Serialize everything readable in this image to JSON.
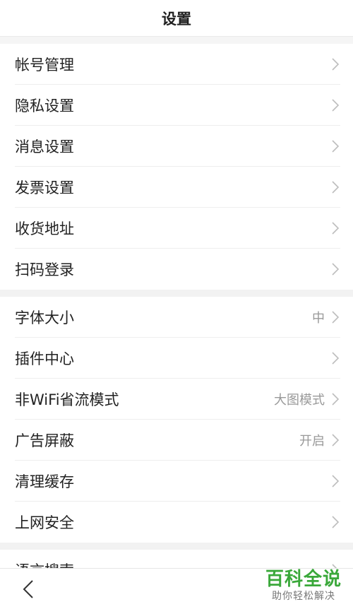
{
  "header": {
    "title": "设置"
  },
  "groups": [
    {
      "items": [
        {
          "label": "帐号管理",
          "value": ""
        },
        {
          "label": "隐私设置",
          "value": ""
        },
        {
          "label": "消息设置",
          "value": ""
        },
        {
          "label": "发票设置",
          "value": ""
        },
        {
          "label": "收货地址",
          "value": ""
        },
        {
          "label": "扫码登录",
          "value": ""
        }
      ]
    },
    {
      "items": [
        {
          "label": "字体大小",
          "value": "中"
        },
        {
          "label": "插件中心",
          "value": ""
        },
        {
          "label": "非WiFi省流模式",
          "value": "大图模式"
        },
        {
          "label": "广告屏蔽",
          "value": "开启"
        },
        {
          "label": "清理缓存",
          "value": ""
        },
        {
          "label": "上网安全",
          "value": ""
        }
      ]
    },
    {
      "items": [
        {
          "label": "语言搜索",
          "value": ""
        }
      ]
    }
  ],
  "watermark": {
    "title": "百科全说",
    "subtitle": "助你轻松解决"
  },
  "colors": {
    "accent": "#3aa83a",
    "secondary_text": "#999999"
  }
}
